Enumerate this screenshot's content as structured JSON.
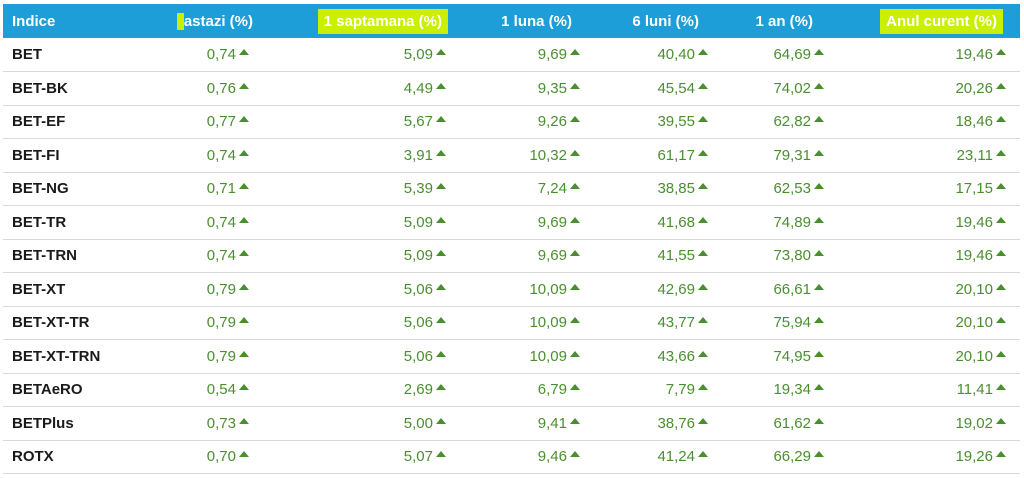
{
  "headers": {
    "indice": "Indice",
    "astazi": "astazi (%)",
    "saptamana": "1 saptamana (%)",
    "luna": "1 luna (%)",
    "sase_luni": "6 luni (%)",
    "an": "1 an (%)",
    "anul_curent": "Anul curent (%)"
  },
  "colors": {
    "header_bg": "#1e9ed9",
    "highlight": "#c8f000",
    "positive": "#4a8f2f"
  },
  "rows": [
    {
      "name": "BET",
      "astazi": "0,74",
      "saptamana": "5,09",
      "luna": "9,69",
      "sase_luni": "40,40",
      "an": "64,69",
      "anul_curent": "19,46"
    },
    {
      "name": "BET-BK",
      "astazi": "0,76",
      "saptamana": "4,49",
      "luna": "9,35",
      "sase_luni": "45,54",
      "an": "74,02",
      "anul_curent": "20,26"
    },
    {
      "name": "BET-EF",
      "astazi": "0,77",
      "saptamana": "5,67",
      "luna": "9,26",
      "sase_luni": "39,55",
      "an": "62,82",
      "anul_curent": "18,46"
    },
    {
      "name": "BET-FI",
      "astazi": "0,74",
      "saptamana": "3,91",
      "luna": "10,32",
      "sase_luni": "61,17",
      "an": "79,31",
      "anul_curent": "23,11"
    },
    {
      "name": "BET-NG",
      "astazi": "0,71",
      "saptamana": "5,39",
      "luna": "7,24",
      "sase_luni": "38,85",
      "an": "62,53",
      "anul_curent": "17,15"
    },
    {
      "name": "BET-TR",
      "astazi": "0,74",
      "saptamana": "5,09",
      "luna": "9,69",
      "sase_luni": "41,68",
      "an": "74,89",
      "anul_curent": "19,46"
    },
    {
      "name": "BET-TRN",
      "astazi": "0,74",
      "saptamana": "5,09",
      "luna": "9,69",
      "sase_luni": "41,55",
      "an": "73,80",
      "anul_curent": "19,46"
    },
    {
      "name": "BET-XT",
      "astazi": "0,79",
      "saptamana": "5,06",
      "luna": "10,09",
      "sase_luni": "42,69",
      "an": "66,61",
      "anul_curent": "20,10"
    },
    {
      "name": "BET-XT-TR",
      "astazi": "0,79",
      "saptamana": "5,06",
      "luna": "10,09",
      "sase_luni": "43,77",
      "an": "75,94",
      "anul_curent": "20,10"
    },
    {
      "name": "BET-XT-TRN",
      "astazi": "0,79",
      "saptamana": "5,06",
      "luna": "10,09",
      "sase_luni": "43,66",
      "an": "74,95",
      "anul_curent": "20,10"
    },
    {
      "name": "BETAeRO",
      "astazi": "0,54",
      "saptamana": "2,69",
      "luna": "6,79",
      "sase_luni": "7,79",
      "an": "19,34",
      "anul_curent": "11,41"
    },
    {
      "name": "BETPlus",
      "astazi": "0,73",
      "saptamana": "5,00",
      "luna": "9,41",
      "sase_luni": "38,76",
      "an": "61,62",
      "anul_curent": "19,02"
    },
    {
      "name": "ROTX",
      "astazi": "0,70",
      "saptamana": "5,07",
      "luna": "9,46",
      "sase_luni": "41,24",
      "an": "66,29",
      "anul_curent": "19,26"
    }
  ],
  "trend_icon": "triangle-up-icon"
}
